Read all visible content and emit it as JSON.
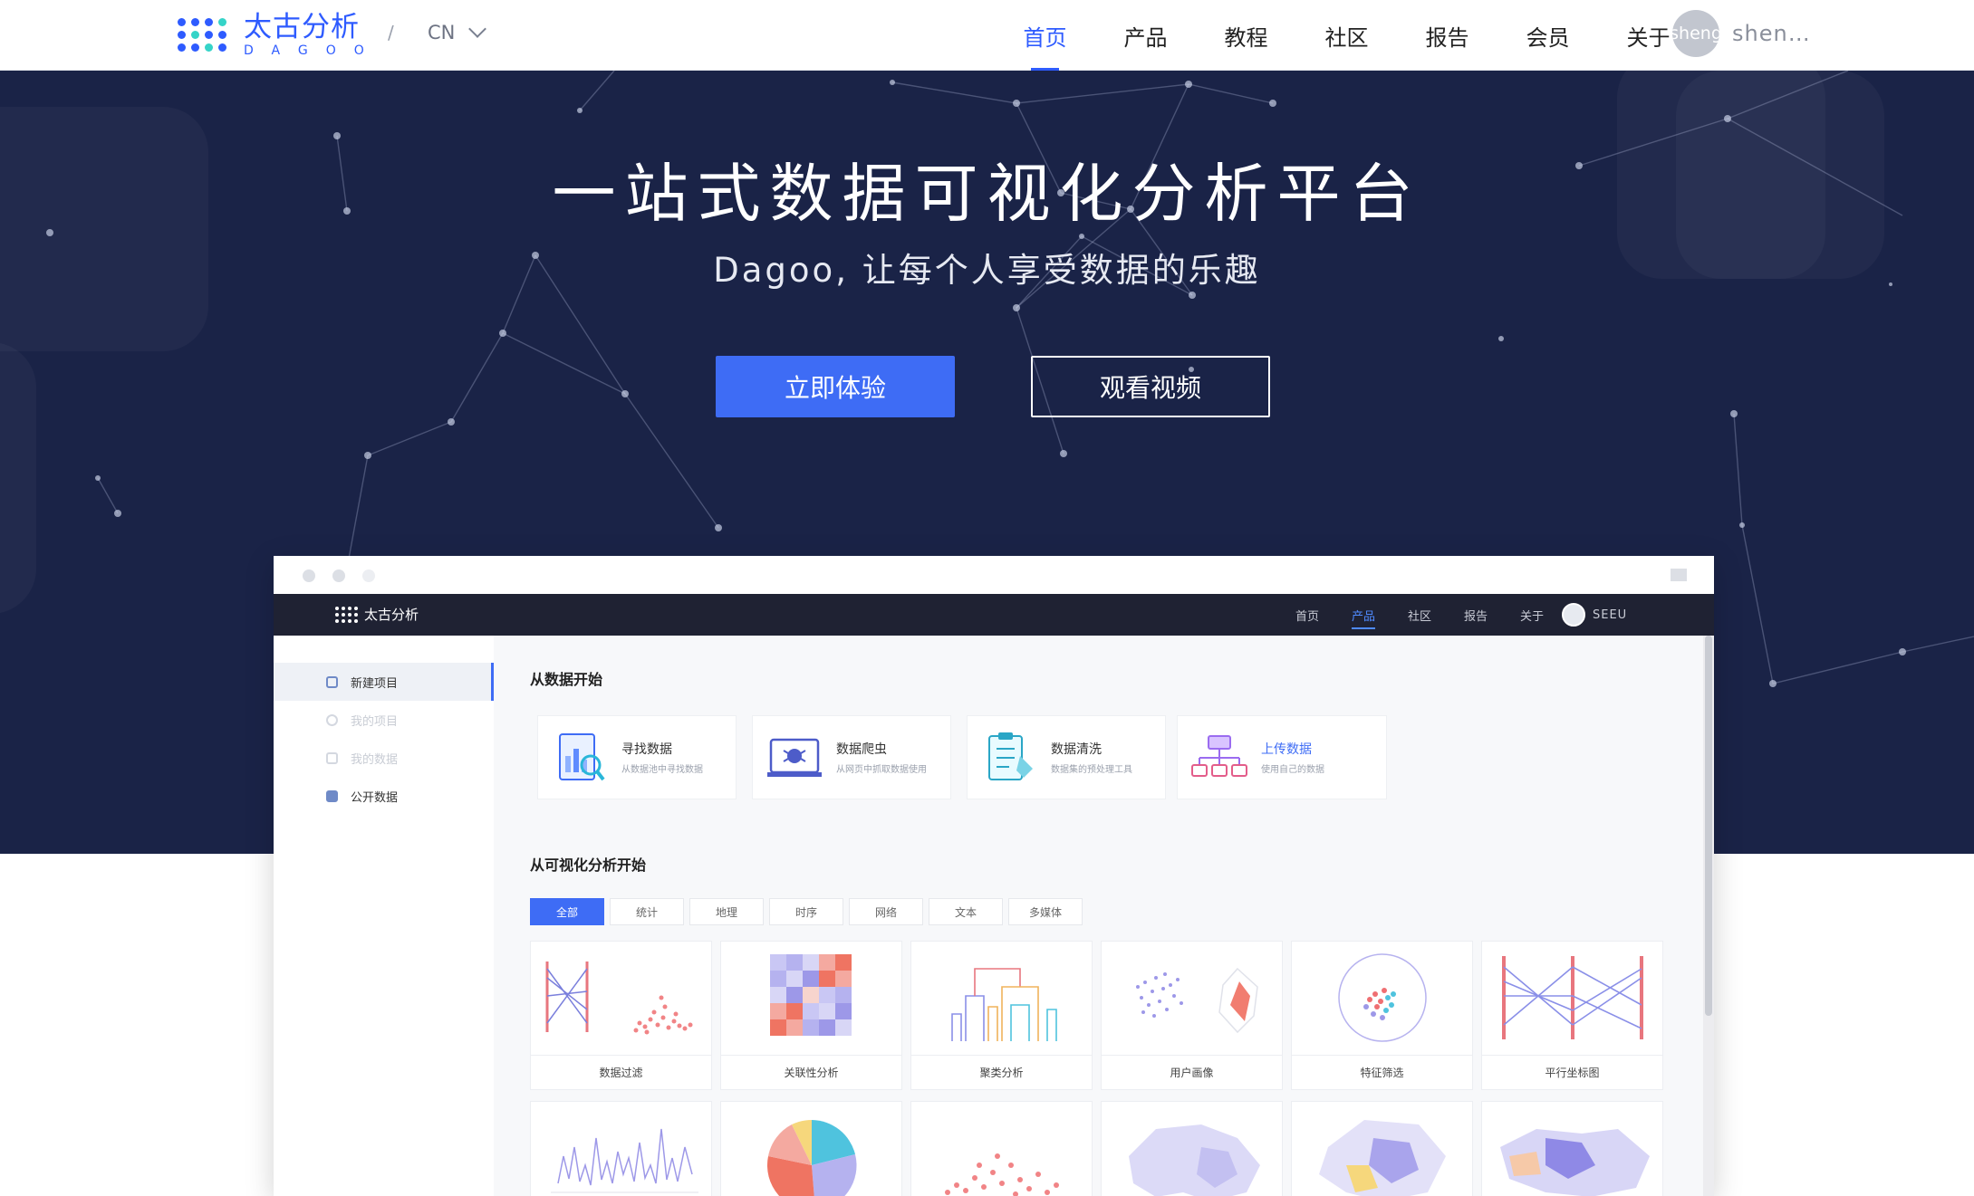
{
  "nav": {
    "logo_cn": "太古分析",
    "logo_en": "DAGOO",
    "lang_sep": "/",
    "lang": "CN",
    "menu": [
      "首页",
      "产品",
      "教程",
      "社区",
      "报告",
      "会员",
      "关于"
    ],
    "active_menu": "首页",
    "avatar_text": "sheng",
    "username": "shen…"
  },
  "hero": {
    "title": "一站式数据可视化分析平台",
    "subtitle": "Dagoo, 让每个人享受数据的乐趣",
    "try_button": "立即体验",
    "video_button": "观看视频"
  },
  "preview": {
    "logo_cn": "太古分析",
    "menu": [
      "首页",
      "产品",
      "社区",
      "报告",
      "关于"
    ],
    "active_menu": "产品",
    "user": "SEEU",
    "sidebar": [
      {
        "label": "新建项目",
        "state": "active"
      },
      {
        "label": "我的项目",
        "state": "faded"
      },
      {
        "label": "我的数据",
        "state": "faded"
      },
      {
        "label": "公开数据",
        "state": "normal"
      }
    ],
    "start_data_heading": "从数据开始",
    "data_sources": [
      {
        "title": "寻找数据",
        "desc": "从数据池中寻找数据"
      },
      {
        "title": "数据爬虫",
        "desc": "从网页中抓取数据使用"
      },
      {
        "title": "数据清洗",
        "desc": "数据集的预处理工具"
      },
      {
        "title": "上传数据",
        "desc": "使用自己的数据"
      }
    ],
    "start_vis_heading": "从可视化分析开始",
    "tabs": [
      "全部",
      "统计",
      "地理",
      "时序",
      "网络",
      "文本",
      "多媒体"
    ],
    "active_tab": "全部",
    "cards": [
      "数据过滤",
      "关联性分析",
      "聚类分析",
      "用户画像",
      "特征筛选",
      "平行坐标图"
    ]
  },
  "colors": {
    "brand": "#2e5bff",
    "hero_bg": "#1a2347",
    "primary_button": "#3e6cf5"
  }
}
